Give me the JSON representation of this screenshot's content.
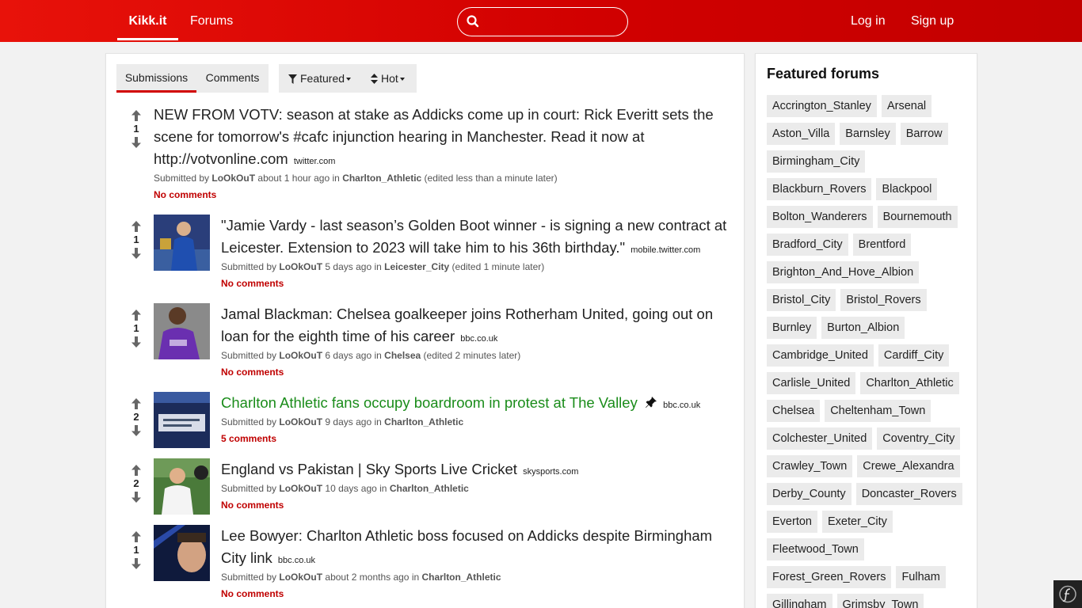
{
  "nav": {
    "brand": "Kikk.it",
    "forums": "Forums",
    "login": "Log in",
    "signup": "Sign up",
    "search_value": ""
  },
  "tabs": {
    "submissions": "Submissions",
    "comments": "Comments"
  },
  "filters": {
    "featured": "Featured",
    "hot": "Hot"
  },
  "posts": [
    {
      "score": "1",
      "title": "NEW FROM VOTV: season at stake as Addicks come up in court: Rick Everitt sets the scene for tomorrow's #cafc injunction hearing in Manchester. Read it now at http://votvonline.com",
      "domain": "twitter.com",
      "submitted": "Submitted by",
      "user": "LoOkOuT",
      "time": "about 1 hour ago",
      "in": "in",
      "forum": "Charlton_Athletic",
      "edited": "(edited less than a minute later)",
      "comments": "No comments"
    },
    {
      "score": "1",
      "title": "\"Jamie Vardy - last season’s Golden Boot winner - is signing a new contract at Leicester. Extension to 2023 will take him to his 36th birthday.\"",
      "domain": "mobile.twitter.com",
      "submitted": "Submitted by",
      "user": "LoOkOuT",
      "time": "5 days ago",
      "in": "in",
      "forum": "Leicester_City",
      "edited": "(edited 1 minute later)",
      "comments": "No comments"
    },
    {
      "score": "1",
      "title": "Jamal Blackman: Chelsea goalkeeper joins Rotherham United, going out on loan for the eighth time of his career",
      "domain": "bbc.co.uk",
      "submitted": "Submitted by",
      "user": "LoOkOuT",
      "time": "6 days ago",
      "in": "in",
      "forum": "Chelsea",
      "edited": "(edited 2 minutes later)",
      "comments": "No comments"
    },
    {
      "score": "2",
      "title": "Charlton Athletic fans occupy boardroom in protest at The Valley",
      "domain": "bbc.co.uk",
      "submitted": "Submitted by",
      "user": "LoOkOuT",
      "time": "9 days ago",
      "in": "in",
      "forum": "Charlton_Athletic",
      "edited": "",
      "comments": "5 comments",
      "pinned": true
    },
    {
      "score": "2",
      "title": "England vs Pakistan | Sky Sports Live Cricket",
      "domain": "skysports.com",
      "submitted": "Submitted by",
      "user": "LoOkOuT",
      "time": "10 days ago",
      "in": "in",
      "forum": "Charlton_Athletic",
      "edited": "",
      "comments": "No comments"
    },
    {
      "score": "1",
      "title": "Lee Bowyer: Charlton Athletic boss focused on Addicks despite Birmingham City link",
      "domain": "bbc.co.uk",
      "submitted": "Submitted by",
      "user": "LoOkOuT",
      "time": "about 2 months ago",
      "in": "in",
      "forum": "Charlton_Athletic",
      "edited": "",
      "comments": "No comments"
    }
  ],
  "sidebar": {
    "title": "Featured forums",
    "forums": [
      "Accrington_Stanley",
      "Arsenal",
      "Aston_Villa",
      "Barnsley",
      "Barrow",
      "Birmingham_City",
      "Blackburn_Rovers",
      "Blackpool",
      "Bolton_Wanderers",
      "Bournemouth",
      "Bradford_City",
      "Brentford",
      "Brighton_And_Hove_Albion",
      "Bristol_City",
      "Bristol_Rovers",
      "Burnley",
      "Burton_Albion",
      "Cambridge_United",
      "Cardiff_City",
      "Carlisle_United",
      "Charlton_Athletic",
      "Chelsea",
      "Cheltenham_Town",
      "Colchester_United",
      "Coventry_City",
      "Crawley_Town",
      "Crewe_Alexandra",
      "Derby_County",
      "Doncaster_Rovers",
      "Everton",
      "Exeter_City",
      "Fleetwood_Town",
      "Forest_Green_Rovers",
      "Fulham",
      "Gillingham",
      "Grimsby_Town"
    ]
  },
  "colors": {
    "brand_red": "#d10000",
    "link_green": "#1a8c1a",
    "comments_red": "#c00000"
  },
  "icons": {
    "search": "search-icon",
    "filter": "filter-icon",
    "sort": "sort-icon",
    "upvote": "arrow-up-icon",
    "downvote": "arrow-down-icon",
    "pin": "pin-icon"
  }
}
